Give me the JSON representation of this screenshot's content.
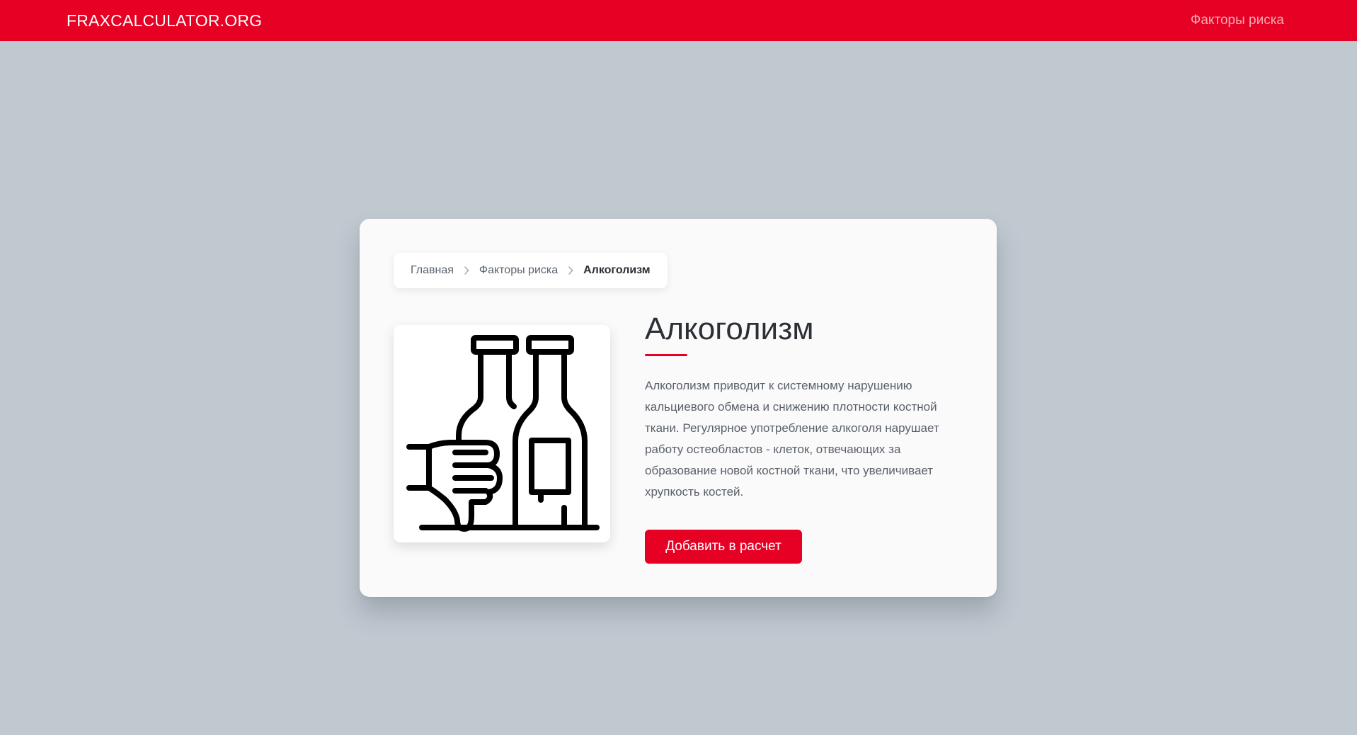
{
  "header": {
    "brand": "FRAXCALCULATOR.ORG",
    "nav_link": "Факторы риска"
  },
  "breadcrumb": {
    "items": [
      "Главная",
      "Факторы риска",
      "Алкоголизм"
    ]
  },
  "content": {
    "image_icon": "bottles-thumbs-down-icon",
    "title": "Алкоголизм",
    "description": "Алкоголизм приводит к системному нарушению кальциевого обмена и снижению плотности костной ткани. Регулярное употребление алкоголя нарушает работу остеобластов - клеток, отвечающих за образование новой костной ткани, что увеличивает хрупкость костей.",
    "button_label": "Добавить в расчет"
  },
  "colors": {
    "accent": "#e60023",
    "page_background": "#c0c8d0",
    "card_background": "#fafafa",
    "nav_link": "#f7a8b4"
  }
}
